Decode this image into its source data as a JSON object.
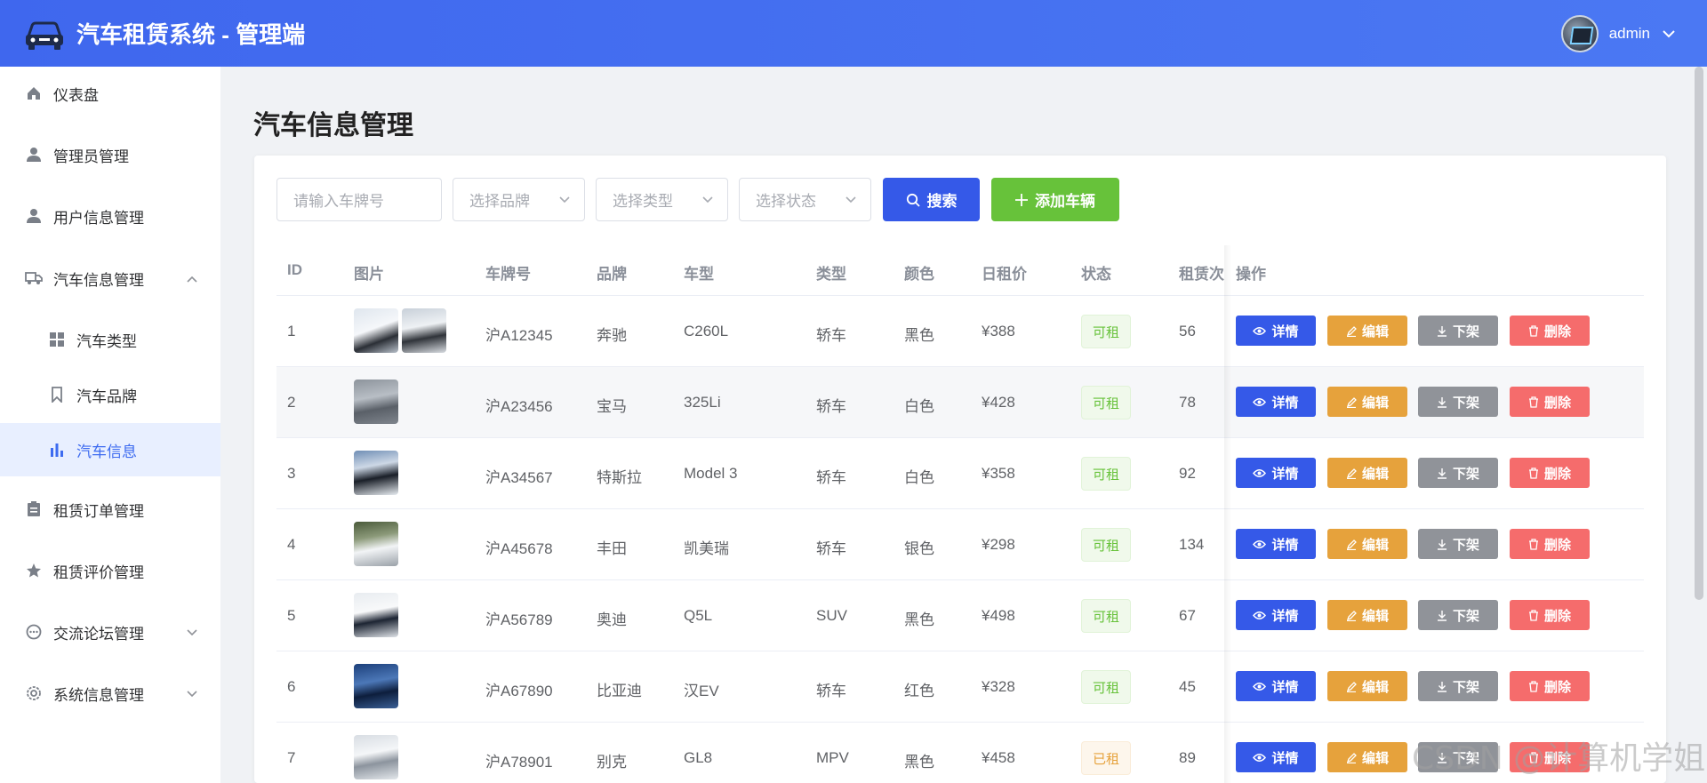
{
  "app": {
    "title": "汽车租赁系统 - 管理端",
    "username": "admin"
  },
  "sidebar": {
    "items": [
      {
        "label": "仪表盘",
        "icon": "home-icon"
      },
      {
        "label": "管理员管理",
        "icon": "user-icon"
      },
      {
        "label": "用户信息管理",
        "icon": "user-icon"
      },
      {
        "label": "汽车信息管理",
        "icon": "truck-icon",
        "expanded": true
      },
      {
        "label": "租赁订单管理",
        "icon": "document-icon"
      },
      {
        "label": "租赁评价管理",
        "icon": "star-icon"
      },
      {
        "label": "交流论坛管理",
        "icon": "chat-icon"
      },
      {
        "label": "系统信息管理",
        "icon": "gear-icon"
      }
    ],
    "submenu": [
      {
        "label": "汽车类型",
        "icon": "grid-icon"
      },
      {
        "label": "汽车品牌",
        "icon": "bookmark-icon"
      },
      {
        "label": "汽车信息",
        "icon": "bar-chart-icon",
        "active": true
      }
    ]
  },
  "page": {
    "title": "汽车信息管理"
  },
  "filters": {
    "plate_placeholder": "请输入车牌号",
    "brand_placeholder": "选择品牌",
    "type_placeholder": "选择类型",
    "status_placeholder": "选择状态",
    "search_label": "搜索",
    "add_label": "添加车辆"
  },
  "table": {
    "columns": [
      "ID",
      "图片",
      "车牌号",
      "品牌",
      "车型",
      "类型",
      "颜色",
      "日租价",
      "状态",
      "租赁次",
      "操作"
    ],
    "rows": [
      {
        "id": "1",
        "plate": "沪A12345",
        "brand": "奔驰",
        "model": "C260L",
        "type": "轿车",
        "color": "黑色",
        "price": "¥388",
        "status": "可租",
        "count": "56"
      },
      {
        "id": "2",
        "plate": "沪A23456",
        "brand": "宝马",
        "model": "325Li",
        "type": "轿车",
        "color": "白色",
        "price": "¥428",
        "status": "可租",
        "count": "78"
      },
      {
        "id": "3",
        "plate": "沪A34567",
        "brand": "特斯拉",
        "model": "Model 3",
        "type": "轿车",
        "color": "白色",
        "price": "¥358",
        "status": "可租",
        "count": "92"
      },
      {
        "id": "4",
        "plate": "沪A45678",
        "brand": "丰田",
        "model": "凯美瑞",
        "type": "轿车",
        "color": "银色",
        "price": "¥298",
        "status": "可租",
        "count": "134"
      },
      {
        "id": "5",
        "plate": "沪A56789",
        "brand": "奥迪",
        "model": "Q5L",
        "type": "SUV",
        "color": "黑色",
        "price": "¥498",
        "status": "可租",
        "count": "67"
      },
      {
        "id": "6",
        "plate": "沪A67890",
        "brand": "比亚迪",
        "model": "汉EV",
        "type": "轿车",
        "color": "红色",
        "price": "¥328",
        "status": "可租",
        "count": "45"
      },
      {
        "id": "7",
        "plate": "沪A78901",
        "brand": "别克",
        "model": "GL8",
        "type": "MPV",
        "color": "黑色",
        "price": "¥458",
        "status": "已租",
        "count": "89"
      }
    ],
    "actions": {
      "detail": "详情",
      "edit": "编辑",
      "off": "下架",
      "delete": "删除"
    }
  },
  "watermark": "CSDN @计算机学姐",
  "colors": {
    "primary": "#3559e8",
    "success": "#67c23a",
    "warning": "#e6a23c",
    "info": "#909399",
    "danger": "#f56c6c",
    "header": "#4470f1"
  }
}
